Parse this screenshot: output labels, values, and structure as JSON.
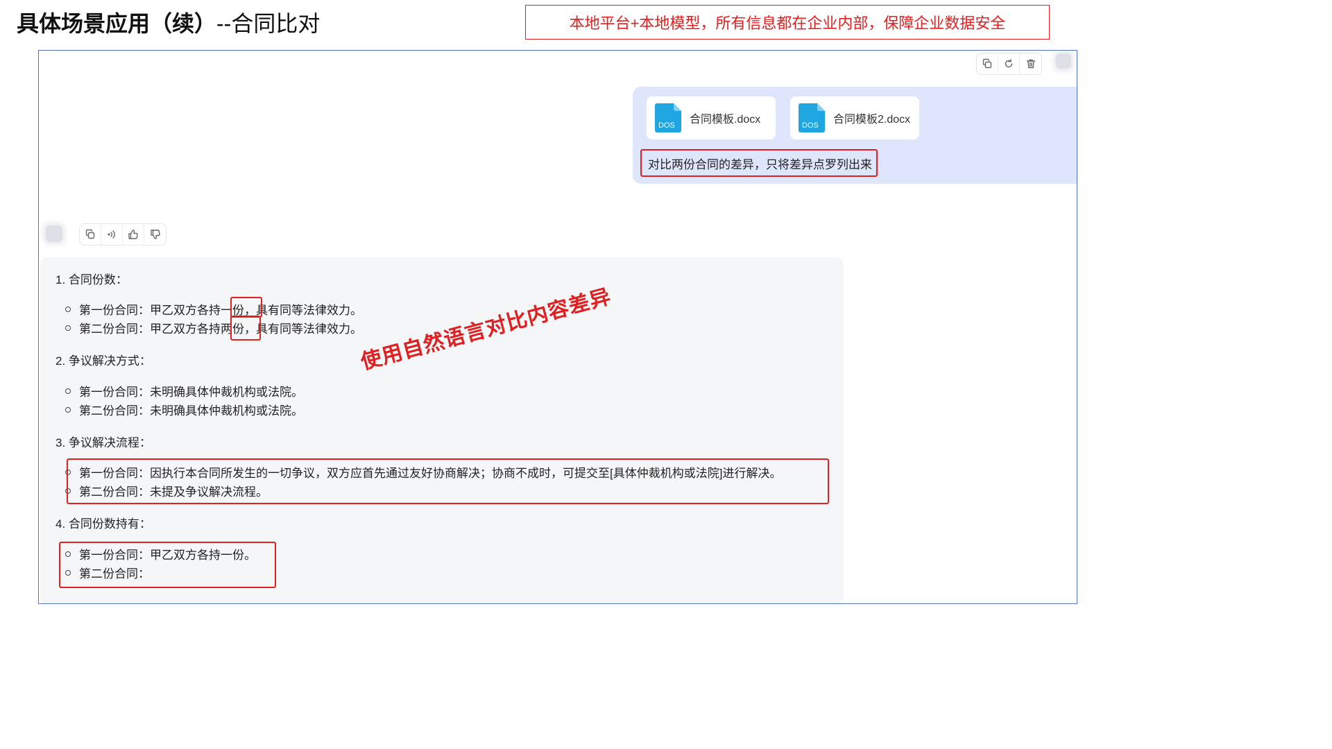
{
  "slide": {
    "title_main": "具体场景应用（续）",
    "title_sub": "--合同比对",
    "note": "本地平台+本地模型，所有信息都在企业内部，保障企业数据安全",
    "overlay_note": "使用自然语言对比内容差异"
  },
  "user_message": {
    "files": [
      {
        "name": "合同模板.docx",
        "icon_label": "DOS",
        "icon": "word-doc-icon"
      },
      {
        "name": "合同模板2.docx",
        "icon_label": "DOS",
        "icon": "word-doc-icon"
      }
    ],
    "prompt": "对比两份合同的差异，只将差异点罗列出来",
    "toolbar": [
      "copy-icon",
      "regenerate-icon",
      "delete-icon"
    ]
  },
  "ai_message": {
    "toolbar": [
      "copy-icon",
      "speaker-icon",
      "thumbs-up-icon",
      "thumbs-down-icon"
    ],
    "sections": [
      {
        "title": "1. 合同份数：",
        "items": [
          {
            "prefix": "第一份合同：甲乙双方各持",
            "highlight": "一份",
            "suffix": "，具有同等法律效力。"
          },
          {
            "prefix": "第二份合同：甲乙双方各持",
            "highlight": "两份",
            "suffix": "，具有同等法律效力。"
          }
        ]
      },
      {
        "title": "2. 争议解决方式：",
        "items": [
          {
            "text": "第一份合同：未明确具体仲裁机构或法院。"
          },
          {
            "text": "第二份合同：未明确具体仲裁机构或法院。"
          }
        ]
      },
      {
        "title": "3. 争议解决流程：",
        "items": [
          {
            "text": "第一份合同：因执行本合同所发生的一切争议，双方应首先通过友好协商解决；协商不成时，可提交至[具体仲裁机构或法院]进行解决。"
          },
          {
            "text": "第二份合同：未提及争议解决流程。"
          }
        ]
      },
      {
        "title": "4. 合同份数持有：",
        "items": [
          {
            "text": "第一份合同：甲乙双方各持一份。"
          },
          {
            "text": "第二份合同："
          }
        ]
      }
    ]
  },
  "colors": {
    "accent_red": "#e02020",
    "window_border": "#4f74c8",
    "user_bubble": "#dfe6fb",
    "answer_bg": "#f5f6f8",
    "doc_icon": "#1fa6e0"
  }
}
